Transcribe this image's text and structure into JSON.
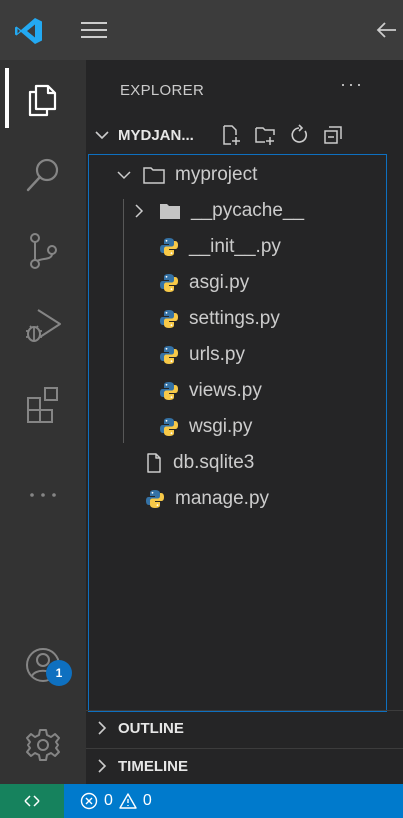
{
  "activity_bar": {
    "items": [
      "explorer-icon",
      "search-icon",
      "source-control-icon",
      "run-debug-icon",
      "extensions-icon",
      "more-icon"
    ],
    "accounts_badge": "1"
  },
  "sidebar": {
    "title": "EXPLORER",
    "more": "···",
    "project": {
      "name": "MYDJAN..."
    },
    "tree": [
      {
        "label": "myproject",
        "type": "folder",
        "expanded": true
      },
      {
        "label": "__pycache__",
        "type": "folder",
        "expanded": false
      },
      {
        "label": "__init__.py",
        "type": "python"
      },
      {
        "label": "asgi.py",
        "type": "python"
      },
      {
        "label": "settings.py",
        "type": "python"
      },
      {
        "label": "urls.py",
        "type": "python"
      },
      {
        "label": "views.py",
        "type": "python"
      },
      {
        "label": "wsgi.py",
        "type": "python"
      },
      {
        "label": "db.sqlite3",
        "type": "file"
      },
      {
        "label": "manage.py",
        "type": "python"
      }
    ],
    "outline": "OUTLINE",
    "timeline": "TIMELINE"
  },
  "status_bar": {
    "errors": "0",
    "warnings": "0"
  },
  "colors": {
    "accent": "#007acc",
    "remote": "#16825d",
    "badge": "#0e70c0",
    "python_blue": "#3572a5",
    "python_yellow": "#f7c948"
  }
}
